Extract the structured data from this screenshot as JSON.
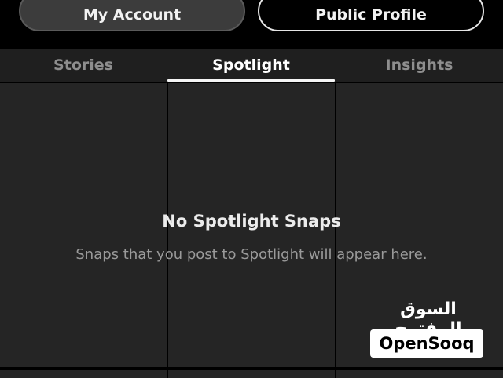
{
  "header": {
    "my_account_label": "My Account",
    "public_profile_label": "Public Profile"
  },
  "tabs": [
    {
      "label": "Stories",
      "active": false
    },
    {
      "label": "Spotlight",
      "active": true
    },
    {
      "label": "Insights",
      "active": false
    }
  ],
  "empty_state": {
    "title": "No Spotlight Snaps",
    "subtitle": "Snaps that you post to Spotlight will appear here."
  },
  "watermark": {
    "arabic_text": "السوق المفتوح",
    "brand_text": "OpenSooq"
  },
  "colors": {
    "background": "#000000",
    "tile": "#252525",
    "tab_bar": "#1f1f1f",
    "active_text": "#ffffff",
    "inactive_text": "#8e8e8e"
  }
}
